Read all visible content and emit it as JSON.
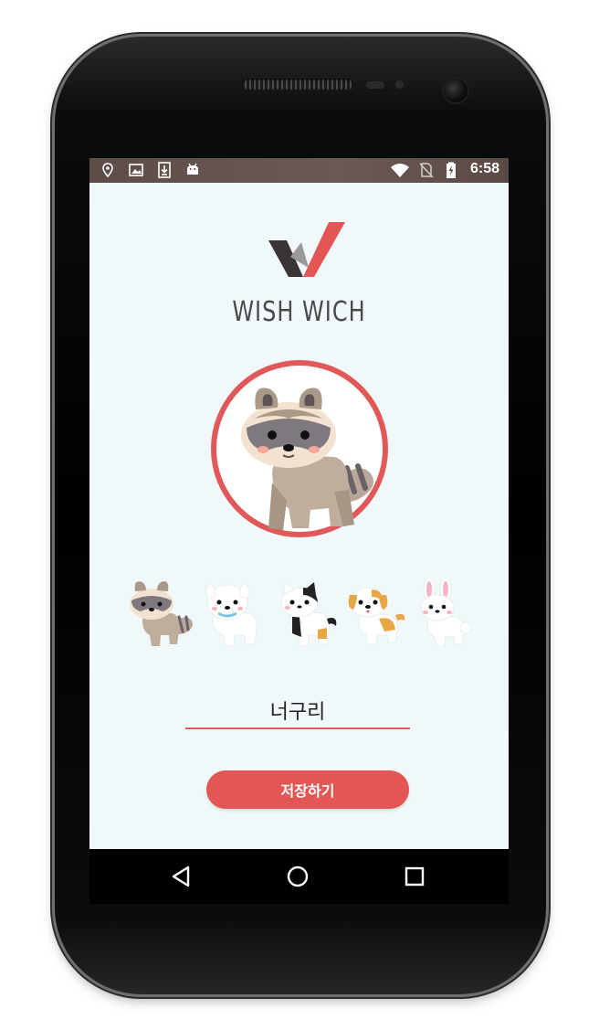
{
  "status_bar": {
    "time": "6:58",
    "left_icons": [
      "location-icon",
      "image-icon",
      "download-icon",
      "android-icon"
    ],
    "right_icons": [
      "wifi-icon",
      "no-sim-icon",
      "battery-charging-icon"
    ]
  },
  "app": {
    "logo_text": "WISH WICH",
    "selected_character": "raccoon",
    "characters": [
      "raccoon",
      "dog",
      "cat",
      "puppy",
      "rabbit"
    ],
    "name_input": {
      "value": "너구리"
    },
    "save_button_label": "저장하기"
  },
  "navigation": {
    "buttons": [
      "back-icon",
      "home-icon",
      "recents-icon"
    ]
  },
  "colors": {
    "accent": "#e25656",
    "background": "#f1f8f9",
    "status_bar": "#5e4c48"
  }
}
